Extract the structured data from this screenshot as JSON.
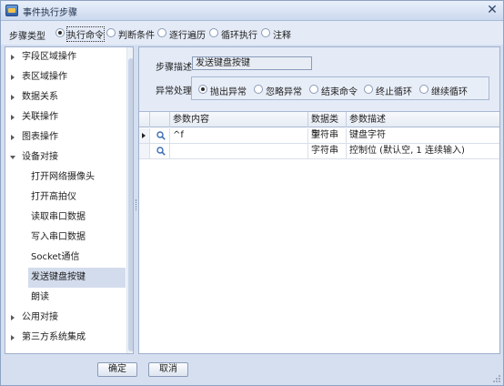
{
  "window": {
    "title": "事件执行步骤",
    "close_glyph": "✕",
    "colors": {
      "frame": "#d5dff0",
      "panel": "#e4ebf7",
      "selection": "#d3dcec",
      "border": "#9fb1cc"
    }
  },
  "step_type": {
    "label": "步骤类型",
    "options": [
      {
        "label": "执行命令",
        "checked": true
      },
      {
        "label": "判断条件",
        "checked": false
      },
      {
        "label": "逐行遍历",
        "checked": false
      },
      {
        "label": "循环执行",
        "checked": false
      },
      {
        "label": "注释",
        "checked": false
      }
    ]
  },
  "tree": {
    "items": [
      {
        "label": "字段区域操作",
        "expanded": false
      },
      {
        "label": "表区域操作",
        "expanded": false
      },
      {
        "label": "数据关系",
        "expanded": false
      },
      {
        "label": "关联操作",
        "expanded": false
      },
      {
        "label": "图表操作",
        "expanded": false
      },
      {
        "label": "设备对接",
        "expanded": true
      },
      {
        "label": "打开网络摄像头",
        "child": true
      },
      {
        "label": "打开高拍仪",
        "child": true
      },
      {
        "label": "读取串口数据",
        "child": true
      },
      {
        "label": "写入串口数据",
        "child": true
      },
      {
        "label": "Socket通信",
        "child": true
      },
      {
        "label": "发送键盘按键",
        "child": true,
        "selected": true
      },
      {
        "label": "朗读",
        "child": true
      },
      {
        "label": "公用对接",
        "expanded": false
      },
      {
        "label": "第三方系统集成",
        "expanded": false
      }
    ]
  },
  "detail": {
    "desc_label": "步骤描述",
    "desc_value": "发送键盘按键",
    "exception_label": "异常处理",
    "exception_options": [
      {
        "label": "抛出异常",
        "checked": true
      },
      {
        "label": "忽略异常",
        "checked": false
      },
      {
        "label": "结束命令",
        "checked": false
      },
      {
        "label": "终止循环",
        "checked": false
      },
      {
        "label": "继续循环",
        "checked": false
      }
    ]
  },
  "grid": {
    "columns": [
      "参数内容",
      "数据类型",
      "参数描述"
    ],
    "rows": [
      {
        "current": true,
        "icon": "search-icon",
        "content": "^f",
        "type": "字符串",
        "desc": "键盘字符"
      },
      {
        "current": false,
        "icon": "search-icon",
        "content": "",
        "type": "字符串",
        "desc": "控制位 (默认空, 1 连续输入)"
      }
    ]
  },
  "buttons": {
    "ok": "确定",
    "cancel": "取消"
  }
}
